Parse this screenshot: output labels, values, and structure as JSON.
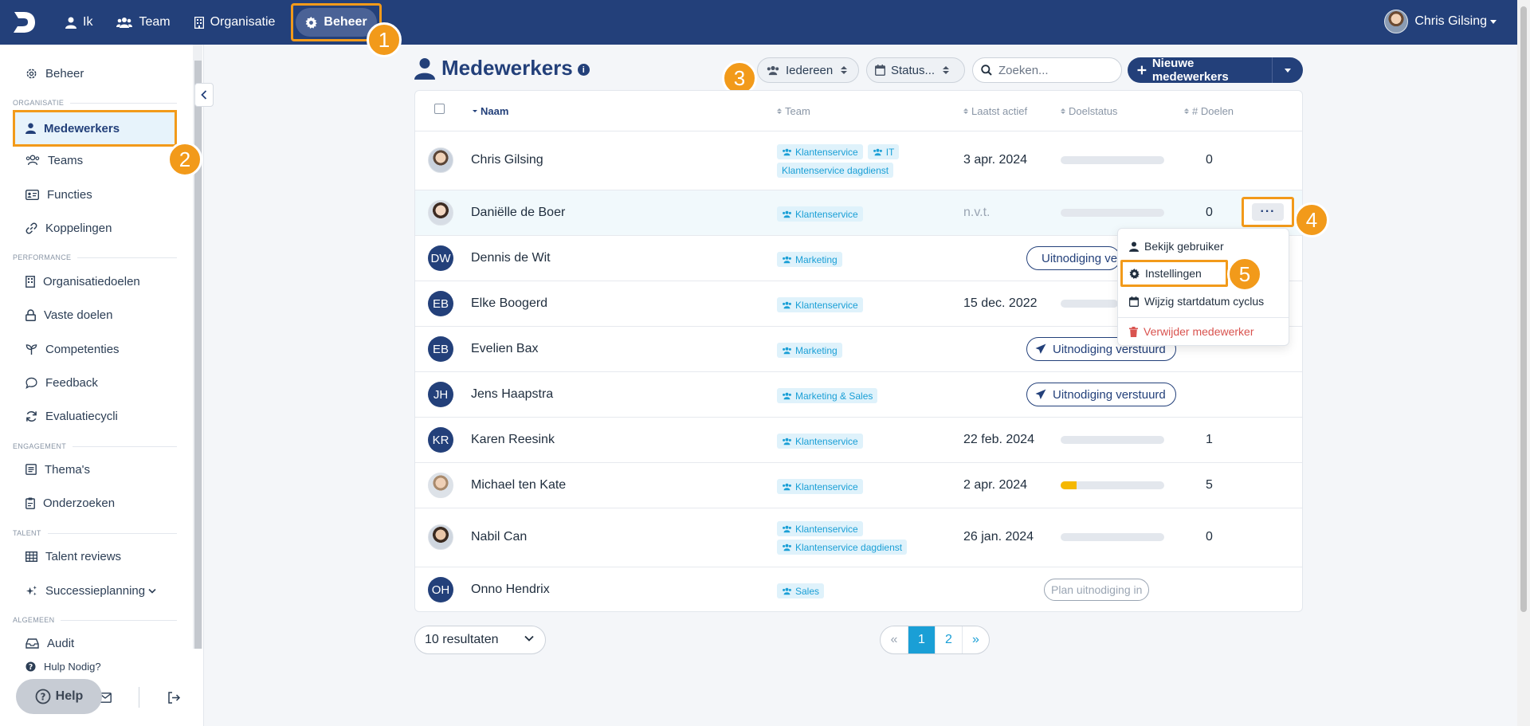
{
  "topbar": {
    "nav": [
      {
        "label": "Ik",
        "icon": "user-icon"
      },
      {
        "label": "Team",
        "icon": "users-icon"
      },
      {
        "label": "Organisatie",
        "icon": "building-icon"
      },
      {
        "label": "Beheer",
        "icon": "gear-icon",
        "active": true
      }
    ],
    "user_name": "Chris Gilsing"
  },
  "sidebar": {
    "top_item": "Beheer",
    "sections": {
      "organisatie": "ORGANISATIE",
      "performance": "PERFORMANCE",
      "engagement": "ENGAGEMENT",
      "talent": "TALENT",
      "algemeen": "ALGEMEEN"
    },
    "items": {
      "medewerkers": "Medewerkers",
      "teams": "Teams",
      "functies": "Functies",
      "koppelingen": "Koppelingen",
      "organisatiedoelen": "Organisatiedoelen",
      "vaste_doelen": "Vaste doelen",
      "competenties": "Competenties",
      "feedback": "Feedback",
      "evaluatiecycli": "Evaluatiecycli",
      "themas": "Thema's",
      "onderzoeken": "Onderzoeken",
      "talent_reviews": "Talent reviews",
      "successieplanning": "Successieplanning",
      "audit": "Audit"
    },
    "hulp": "Hulp Nodig?",
    "help_button": "Help"
  },
  "steps": [
    "1",
    "2",
    "3",
    "4",
    "5"
  ],
  "header": {
    "title": "Medewerkers",
    "filter_who": "Iedereen",
    "filter_status": "Status...",
    "search_placeholder": "Zoeken...",
    "new_button": "Nieuwe medewerkers"
  },
  "table": {
    "columns": {
      "naam": "Naam",
      "team": "Team",
      "laatst_actief": "Laatst actief",
      "doelstatus": "Doelstatus",
      "doelen": "# Doelen"
    },
    "rows": [
      {
        "initials": "",
        "name": "Chris Gilsing",
        "tags": [
          "Klantenservice",
          "IT",
          "Klantenservice dagdienst"
        ],
        "last_active": "3 apr. 2024",
        "progress": 0,
        "goals": "0"
      },
      {
        "initials": "",
        "name": "Daniëlle de Boer",
        "tags": [
          "Klantenservice"
        ],
        "last_active": "n.v.t.",
        "progress": 0,
        "goals": "0"
      },
      {
        "initials": "DW",
        "name": "Dennis de Wit",
        "tags": [
          "Marketing"
        ],
        "invite": "Uitnodiging verstuurd"
      },
      {
        "initials": "EB",
        "name": "Elke Boogerd",
        "tags": [
          "Klantenservice"
        ],
        "last_active": "15 dec. 2022",
        "progress": 0
      },
      {
        "initials": "EB",
        "name": "Evelien Bax",
        "tags": [
          "Marketing"
        ],
        "invite": "Uitnodiging verstuurd"
      },
      {
        "initials": "JH",
        "name": "Jens Haapstra",
        "tags": [
          "Marketing & Sales"
        ],
        "invite": "Uitnodiging verstuurd"
      },
      {
        "initials": "KR",
        "name": "Karen Reesink",
        "tags": [
          "Klantenservice"
        ],
        "last_active": "22 feb. 2024",
        "progress": 0,
        "goals": "1"
      },
      {
        "initials": "",
        "name": "Michael ten Kate",
        "tags": [
          "Klantenservice"
        ],
        "last_active": "2 apr. 2024",
        "progress": 0.15,
        "goals": "5"
      },
      {
        "initials": "",
        "name": "Nabil Can",
        "tags": [
          "Klantenservice",
          "Klantenservice dagdienst"
        ],
        "last_active": "26 jan. 2024",
        "progress": 0,
        "goals": "0"
      },
      {
        "initials": "OH",
        "name": "Onno Hendrix",
        "tags": [
          "Sales"
        ],
        "plan": "Plan uitnodiging in"
      }
    ]
  },
  "row_menu": {
    "more": "···",
    "view": "Bekijk gebruiker",
    "settings": "Instellingen",
    "change_start": "Wijzig startdatum cyclus",
    "delete": "Verwijder medewerker"
  },
  "footer": {
    "per_page": "10 resultaten",
    "prev": "«",
    "pages": [
      "1",
      "2"
    ],
    "next": "»"
  },
  "colors": {
    "brand": "#23407a",
    "accent": "#f29a1a",
    "tag": "#1a9fd6",
    "progress": "#f5b800"
  }
}
